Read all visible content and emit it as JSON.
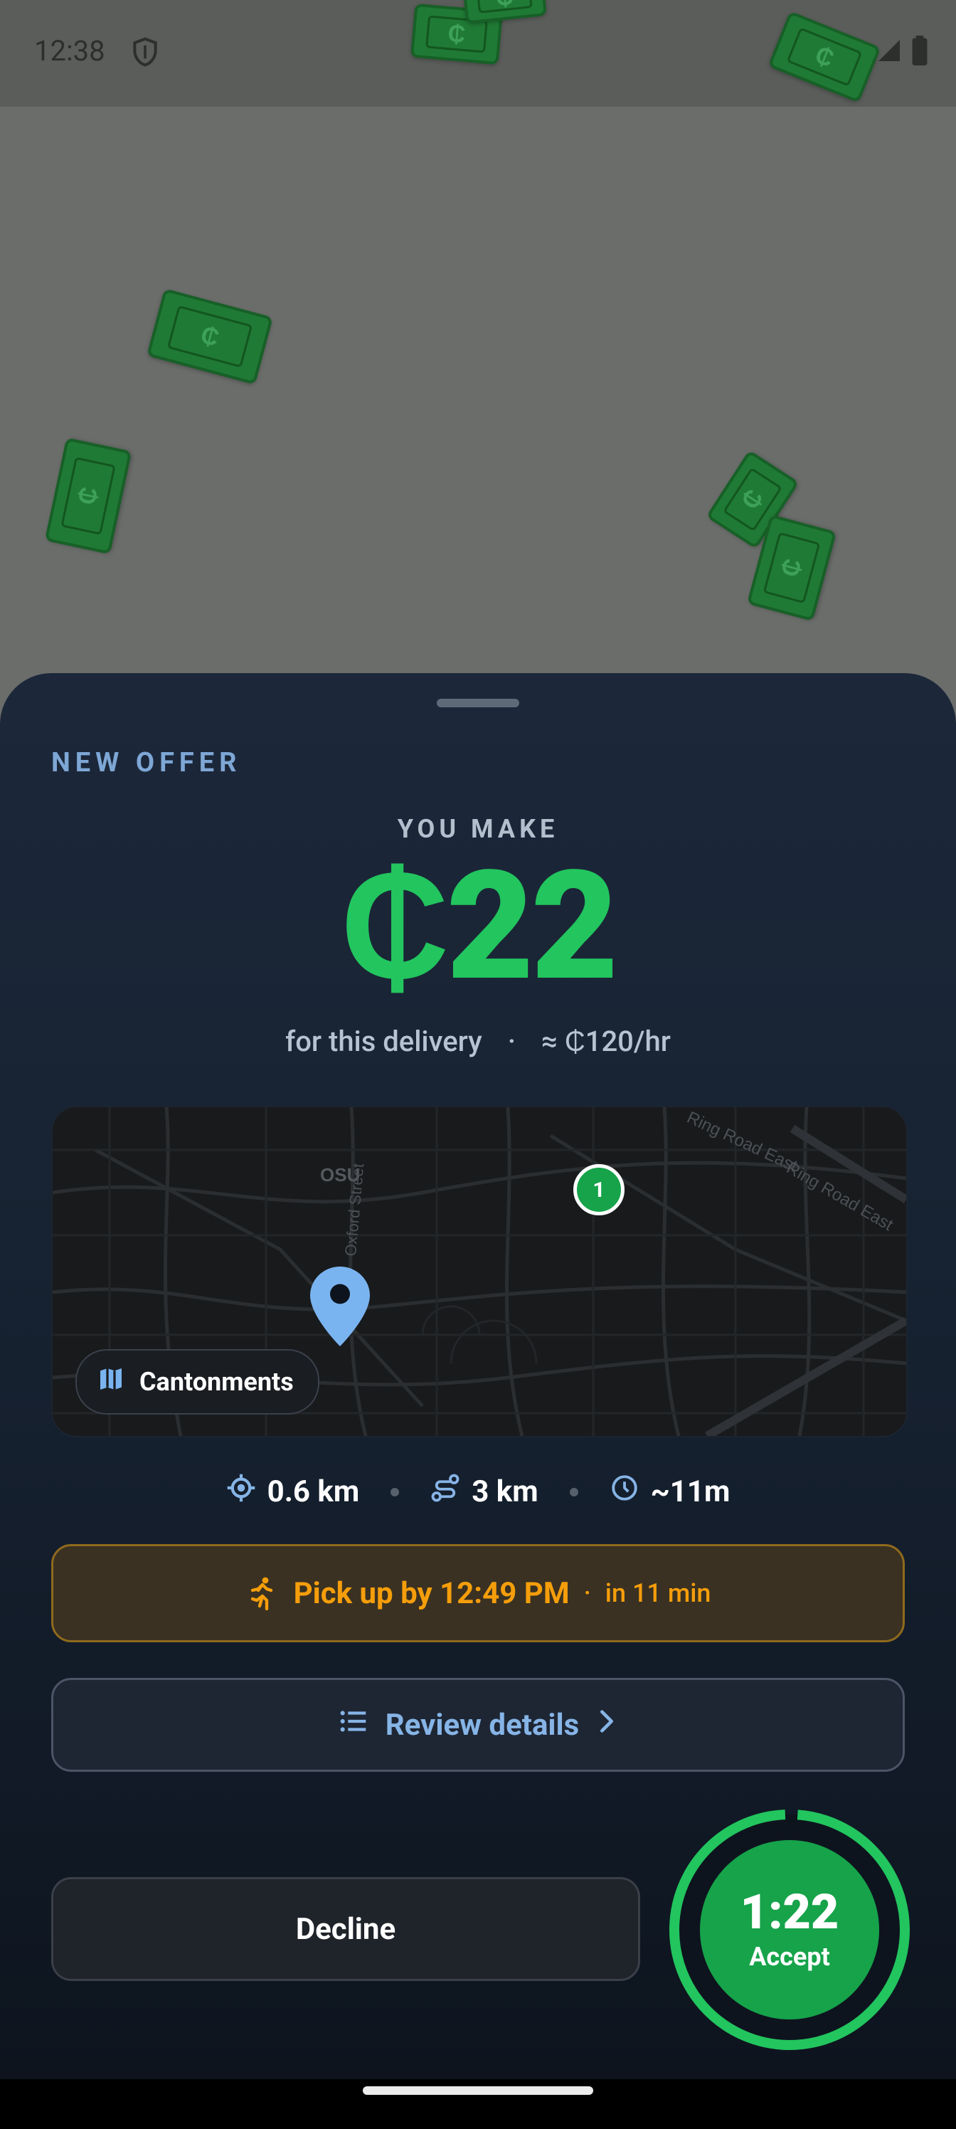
{
  "status_bar": {
    "time": "12:38"
  },
  "bills": [
    "₵",
    "₵",
    "₵",
    "₵",
    "₵",
    "₵",
    "₵"
  ],
  "offer": {
    "header": "NEW OFFER",
    "you_make_label": "YOU MAKE",
    "amount": "₵22",
    "subtitle_left": "for this delivery",
    "subtitle_sep": "·",
    "subtitle_right": "≈ ₵120/hr"
  },
  "map": {
    "stop_number": "1",
    "chip_label": "Cantonments",
    "labels": [
      "OSU",
      "Oxford Street",
      "Ring Road East",
      "Ring Road East"
    ]
  },
  "stats": [
    {
      "icon": "location-target-icon",
      "value": "0.6 km"
    },
    {
      "icon": "route-icon",
      "value": "3 km"
    },
    {
      "icon": "clock-icon",
      "value": "~11m"
    }
  ],
  "pickup": {
    "main": "Pick up by 12:49 PM",
    "sep": "·",
    "eta": "in 11 min"
  },
  "review": {
    "label": "Review details"
  },
  "actions": {
    "decline": "Decline",
    "timer": "1:22",
    "accept": "Accept"
  },
  "colors": {
    "accent_green": "#22c55e",
    "warning": "#f59e0b",
    "link_blue": "#86b4e6"
  }
}
